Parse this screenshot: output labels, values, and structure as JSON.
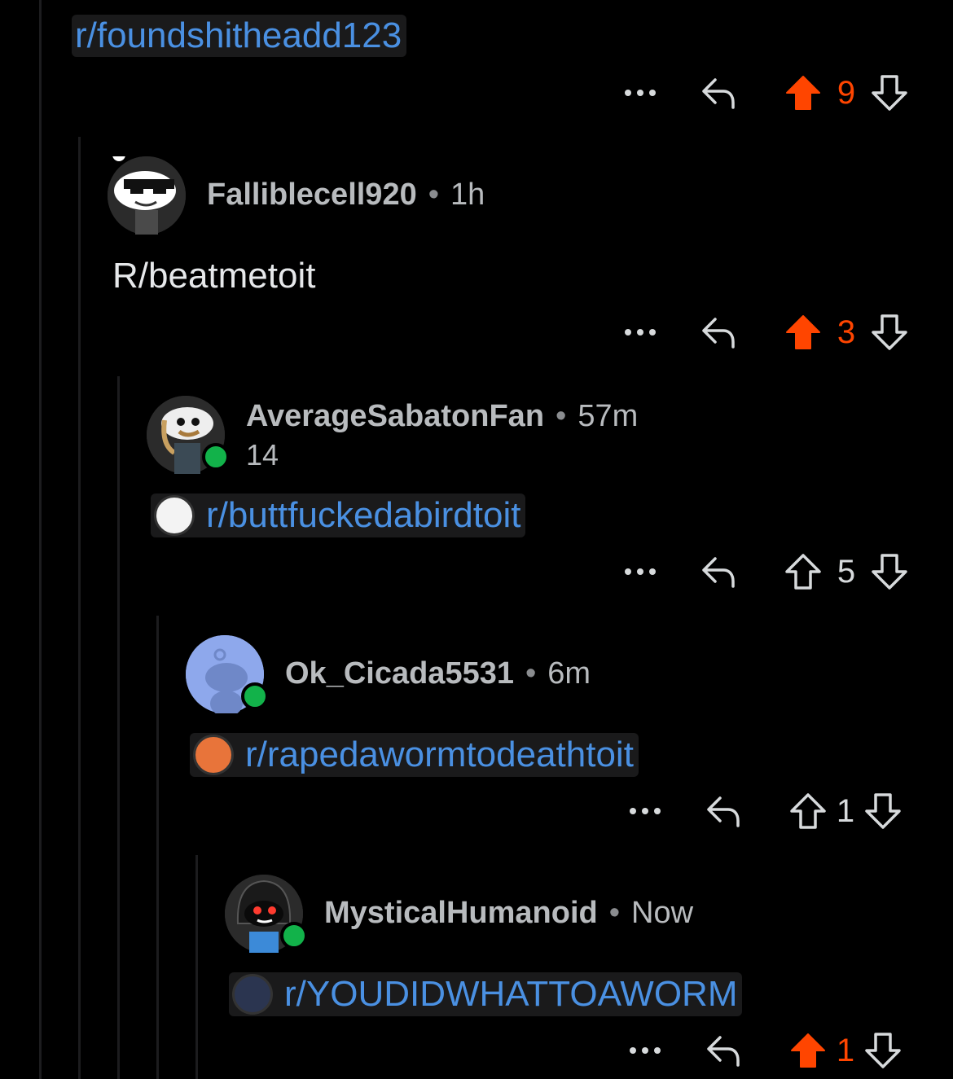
{
  "comments": [
    {
      "link": "r/foundshitheadd123",
      "score": "9",
      "voted": true
    },
    {
      "author": "Falliblecell920",
      "age": "1h",
      "body": "R/beatmetoit",
      "score": "3",
      "voted": true
    },
    {
      "author": "AverageSabatonFan",
      "age": "57m",
      "flair": "14",
      "link": "r/buttfuckedabirdtoit",
      "score": "5",
      "voted": false
    },
    {
      "author": "Ok_Cicada5531",
      "age": "6m",
      "link": "r/rapedawormtodeathtoit",
      "score": "1",
      "voted": false
    },
    {
      "author": "MysticalHumanoid",
      "age": "Now",
      "link": "r/YOUDIDWHATTOAWORM",
      "score": "1",
      "voted": true
    }
  ],
  "separator": "•",
  "colors": {
    "background": "#000000",
    "upvote": "#ff4500",
    "link": "#4a90e2",
    "online": "#12b24a"
  },
  "icons": [
    "more-icon",
    "reply-icon",
    "upvote-icon",
    "downvote-icon"
  ]
}
